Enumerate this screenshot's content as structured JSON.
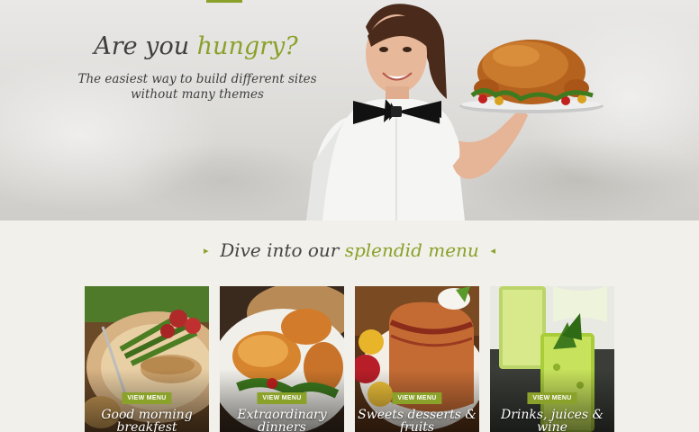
{
  "hero": {
    "title_pre": "Are you ",
    "title_accent": "hungry?",
    "subtitle_line1": "The easiest way to build different sites",
    "subtitle_line2": "without many themes"
  },
  "menu_section": {
    "title_pre": "Dive into our ",
    "title_accent": "splendid menu",
    "arrow_left": "▸",
    "arrow_right": "◂"
  },
  "cards": [
    {
      "button": "VIEW MENU",
      "title": "Good morning breakfest"
    },
    {
      "button": "VIEW MENU",
      "title": "Extraordinary dinners"
    },
    {
      "button": "VIEW MENU",
      "title": "Sweets desserts & fruits"
    },
    {
      "button": "VIEW MENU",
      "title": "Drinks, juices & wine"
    }
  ],
  "colors": {
    "accent": "#8aa12a",
    "background": "#f1f0ea",
    "text": "#3f3f3f"
  }
}
